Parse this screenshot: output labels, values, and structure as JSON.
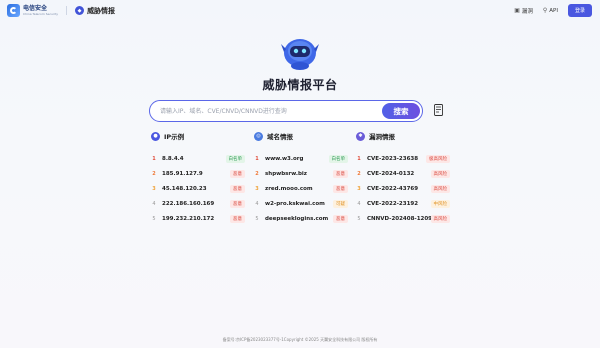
{
  "brand": {
    "name": "电信安全",
    "sub": "China Telecom Security"
  },
  "app": {
    "name": "威胁情报"
  },
  "nav": {
    "vuln": "漏洞",
    "api": "API",
    "login": "登录"
  },
  "title": "威胁情报平台",
  "search": {
    "placeholder": "请输入IP、域名、CVE/CNVD/CNNVD进行查询",
    "button": "搜索"
  },
  "columns": [
    {
      "title": "IP示例",
      "rows": [
        {
          "rank": "1",
          "value": "8.8.4.4",
          "tag": "白名单",
          "tag_type": "white"
        },
        {
          "rank": "2",
          "value": "185.91.127.9",
          "tag": "恶意",
          "tag_type": "mal"
        },
        {
          "rank": "3",
          "value": "45.148.120.23",
          "tag": "恶意",
          "tag_type": "mal"
        },
        {
          "rank": "4",
          "value": "222.186.160.169",
          "tag": "恶意",
          "tag_type": "mal"
        },
        {
          "rank": "5",
          "value": "199.232.210.172",
          "tag": "恶意",
          "tag_type": "mal"
        }
      ]
    },
    {
      "title": "域名情报",
      "rows": [
        {
          "rank": "1",
          "value": "www.w3.org",
          "tag": "白名单",
          "tag_type": "white"
        },
        {
          "rank": "2",
          "value": "shpwbsrw.biz",
          "tag": "恶意",
          "tag_type": "mal"
        },
        {
          "rank": "3",
          "value": "zred.mooo.com",
          "tag": "恶意",
          "tag_type": "mal"
        },
        {
          "rank": "4",
          "value": "w2-pro.kskwai.com",
          "tag": "可疑",
          "tag_type": "sus"
        },
        {
          "rank": "5",
          "value": "deepseeklogins.com",
          "tag": "恶意",
          "tag_type": "mal"
        }
      ]
    },
    {
      "title": "漏洞情报",
      "rows": [
        {
          "rank": "1",
          "value": "CVE-2023-23638",
          "tag": "极高风险",
          "tag_type": "high"
        },
        {
          "rank": "2",
          "value": "CVE-2024-0132",
          "tag": "高风险",
          "tag_type": "high"
        },
        {
          "rank": "3",
          "value": "CVE-2022-43769",
          "tag": "高风险",
          "tag_type": "high"
        },
        {
          "rank": "4",
          "value": "CVE-2022-23192",
          "tag": "中风险",
          "tag_type": "mid"
        },
        {
          "rank": "5",
          "value": "CNNVD-202408-1209",
          "tag": "高风险",
          "tag_type": "high"
        }
      ]
    }
  ],
  "footer": "备案号:京ICP备2023023377号-1Copyright ©2025 天翼安全科技有限公司 版权所有",
  "colors": {
    "accent": "#4a57e0",
    "ip_icon": "#4a57e0",
    "domain_icon": "#4a7be0",
    "vuln_icon": "#6a5cd8"
  }
}
